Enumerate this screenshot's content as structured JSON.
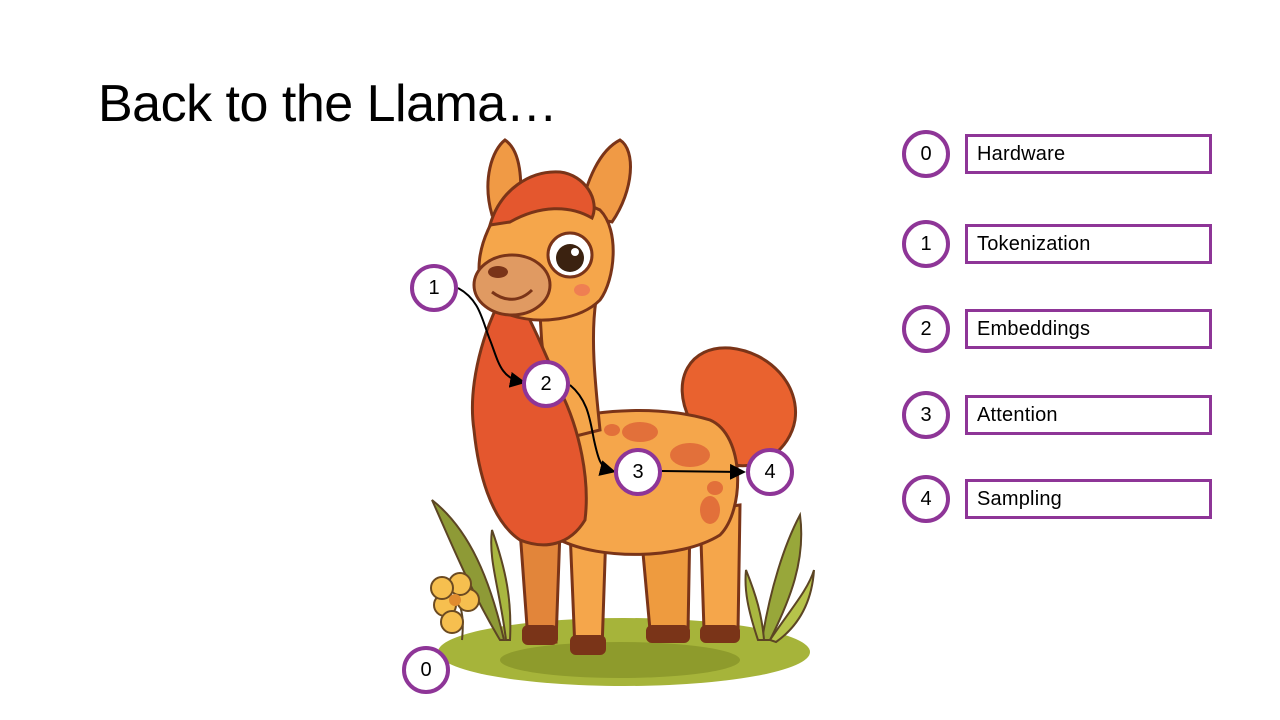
{
  "slide": {
    "title": "Back to the Llama…"
  },
  "markers": [
    {
      "number": "0"
    },
    {
      "number": "1"
    },
    {
      "number": "2"
    },
    {
      "number": "3"
    },
    {
      "number": "4"
    }
  ],
  "legend": [
    {
      "number": "0",
      "label": "Hardware"
    },
    {
      "number": "1",
      "label": "Tokenization"
    },
    {
      "number": "2",
      "label": "Embeddings"
    },
    {
      "number": "3",
      "label": "Attention"
    },
    {
      "number": "4",
      "label": "Sampling"
    }
  ],
  "colors": {
    "accent": "#8e3597",
    "llama_body": "#f5a64b",
    "llama_mane": "#e4572e",
    "grass": "#a6b43a"
  }
}
